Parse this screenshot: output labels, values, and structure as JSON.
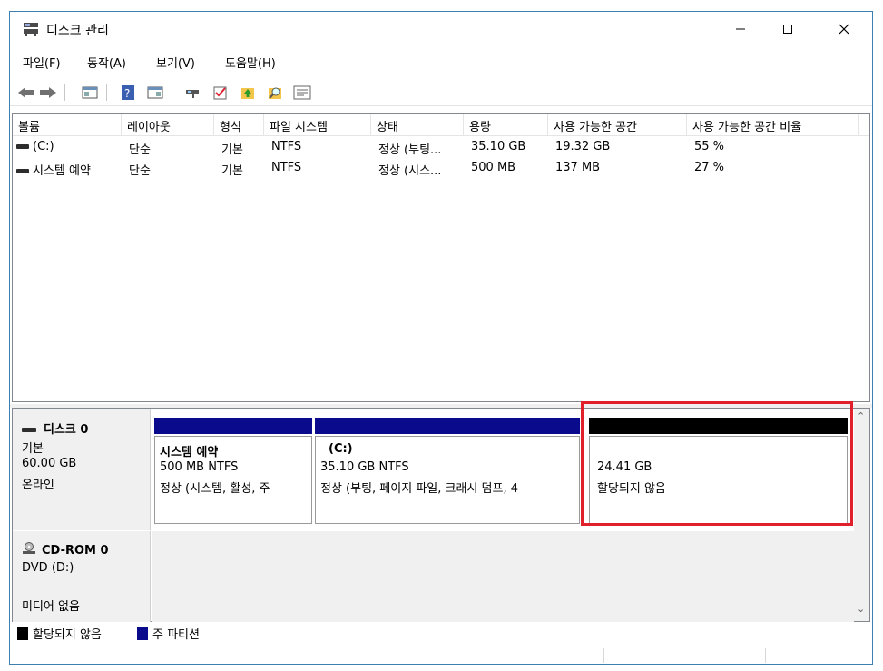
{
  "window": {
    "title": "디스크 관리"
  },
  "menu": [
    "파일(F)",
    "동작(A)",
    "보기(V)",
    "도움말(H)"
  ],
  "columns": [
    "볼륨",
    "레이아웃",
    "형식",
    "파일 시스템",
    "상태",
    "용량",
    "사용 가능한 공간",
    "사용 가능한 공간 비율"
  ],
  "volumes": [
    {
      "name": "(C:)",
      "layout": "단순",
      "type": "기본",
      "fs": "NTFS",
      "status": "정상 (부팅...",
      "capacity": "35.10 GB",
      "free": "19.32 GB",
      "pct": "55 %"
    },
    {
      "name": "시스템 예약",
      "layout": "단순",
      "type": "기본",
      "fs": "NTFS",
      "status": "정상 (시스...",
      "capacity": "500 MB",
      "free": "137 MB",
      "pct": "27 %"
    }
  ],
  "disk0": {
    "name": "디스크 0",
    "type": "기본",
    "size": "60.00 GB",
    "state": "온라인",
    "partitions": [
      {
        "title": "시스템 예약",
        "line1": "500 MB NTFS",
        "line2": "정상 (시스템, 활성, 주",
        "bar_color": "#0a0a8c"
      },
      {
        "title": "(C:)",
        "line1": "35.10 GB NTFS",
        "line2": "정상 (부팅, 페이지 파일, 크래시 덤프, 4",
        "bar_color": "#0a0a8c"
      },
      {
        "title": "",
        "line1": "24.41 GB",
        "line2": "할당되지 않음",
        "bar_color": "#000000"
      }
    ]
  },
  "cdrom": {
    "name": "CD-ROM 0",
    "drive": "DVD (D:)",
    "state": "미디어 없음"
  },
  "legend": [
    {
      "label": "할당되지 않음",
      "color": "#000000"
    },
    {
      "label": "주 파티션",
      "color": "#0a0a8c"
    }
  ],
  "icons": {
    "app": "disk-management-icon",
    "toolbar": [
      "back-icon",
      "forward-icon",
      "console-tree-icon",
      "help-icon",
      "details-pane-icon",
      "connect-icon",
      "check-icon",
      "up-arrow-icon",
      "search-icon",
      "properties-icon"
    ]
  },
  "colors": {
    "highlight": "#e0202a",
    "primary_partition": "#0a0a8c",
    "unallocated": "#000000"
  }
}
